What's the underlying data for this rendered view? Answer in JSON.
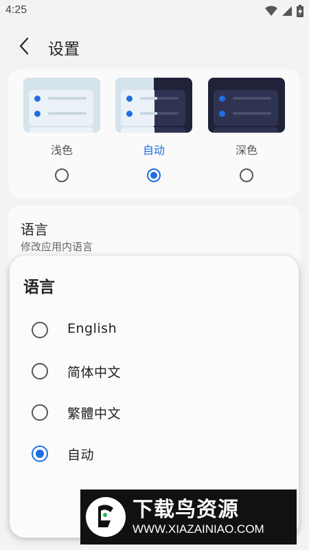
{
  "status_bar": {
    "time": "4:25",
    "icons": [
      "wifi-icon",
      "signal-icon",
      "battery-charging-icon"
    ]
  },
  "header": {
    "title": "设置",
    "back_icon": "chevron-left-icon"
  },
  "theme": {
    "options": [
      {
        "label": "浅色",
        "selected": false
      },
      {
        "label": "自动",
        "selected": true
      },
      {
        "label": "深色",
        "selected": false
      }
    ],
    "colors": {
      "accent": "#1e6fe0",
      "light_bg": "#d4e3ec",
      "dark_bg": "#1f2238"
    }
  },
  "language_setting": {
    "title": "语言",
    "subtitle": "修改应用内语言"
  },
  "language_dialog": {
    "title": "语言",
    "options": [
      {
        "label": "English",
        "selected": false
      },
      {
        "label": "简体中文",
        "selected": false
      },
      {
        "label": "繁體中文",
        "selected": false
      },
      {
        "label": "自动",
        "selected": true
      }
    ]
  },
  "watermark": {
    "name": "下载鸟资源",
    "url": "WWW.XIAZAINIAO.COM"
  }
}
